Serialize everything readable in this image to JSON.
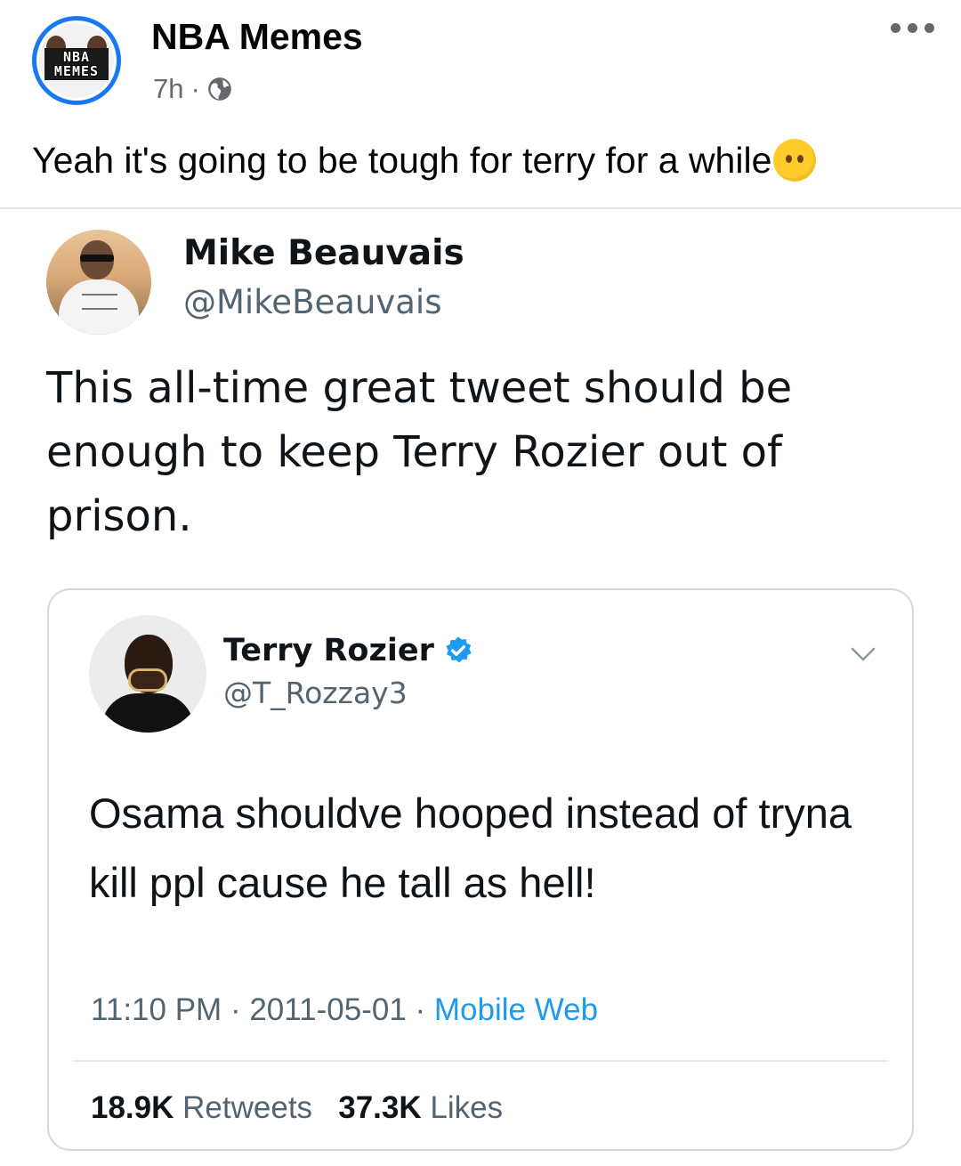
{
  "post": {
    "page_name": "NBA Memes",
    "logo_text": [
      "NBA",
      "MEMES"
    ],
    "time": "7h",
    "separator": "·",
    "caption": "Yeah it's going to be tough for terry for a while",
    "icons": {
      "globe": "globe-icon",
      "more": "more-icon",
      "emoji": "grimacing-no-mouth-emoji"
    }
  },
  "tweet": {
    "name": "Mike Beauvais",
    "handle": "@MikeBeauvais",
    "text": "This all-time great tweet should be enough to keep Terry Rozier out of prison."
  },
  "quoted_tweet": {
    "name": "Terry Rozier",
    "handle": "@T_Rozzay3",
    "text": "Osama shouldve hooped instead of tryna kill ppl cause he tall as hell!",
    "time": "11:10 PM",
    "date": "2011-05-01",
    "source": "Mobile Web",
    "retweets_count": "18.9K",
    "retweets_label": "Retweets",
    "likes_count": "37.3K",
    "likes_label": "Likes",
    "dot": "·"
  },
  "colors": {
    "facebook_blue": "#1877f2",
    "twitter_blue": "#1d9bf0",
    "muted": "#536471"
  }
}
